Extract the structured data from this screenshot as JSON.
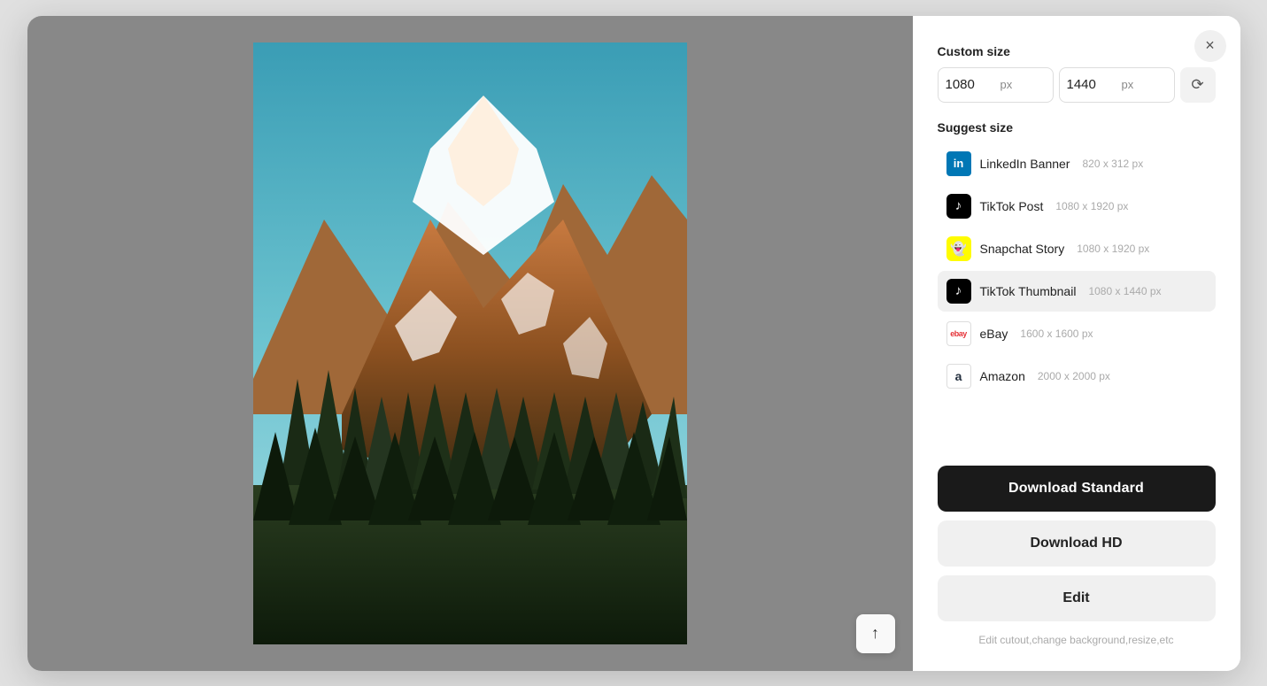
{
  "modal": {
    "close_label": "×"
  },
  "custom_size": {
    "label": "Custom size",
    "width_value": "1080",
    "height_value": "1440",
    "width_unit": "px",
    "height_unit": "px",
    "aspect_icon": "⟳"
  },
  "suggest_size": {
    "label": "Suggest size",
    "items": [
      {
        "id": "linkedin-banner",
        "icon_type": "li",
        "icon_text": "in",
        "name": "LinkedIn Banner",
        "dims": "820 x 312 px",
        "active": false
      },
      {
        "id": "tiktok-post",
        "icon_type": "tt",
        "icon_text": "♪",
        "name": "TikTok Post",
        "dims": "1080 x 1920 px",
        "active": false
      },
      {
        "id": "snapchat-story",
        "icon_type": "sc",
        "icon_text": "👻",
        "name": "Snapchat Story",
        "dims": "1080 x 1920 px",
        "active": false
      },
      {
        "id": "tiktok-thumbnail",
        "icon_type": "tt",
        "icon_text": "♪",
        "name": "TikTok Thumbnail",
        "dims": "1080 x 1440 px",
        "active": true
      },
      {
        "id": "ebay",
        "icon_type": "eb",
        "icon_text": "ebay",
        "name": "eBay",
        "dims": "1600 x 1600 px",
        "active": false
      },
      {
        "id": "amazon",
        "icon_type": "az",
        "icon_text": "a",
        "name": "Amazon",
        "dims": "2000 x 2000 px",
        "active": false
      }
    ]
  },
  "actions": {
    "download_standard": "Download Standard",
    "download_hd": "Download HD",
    "edit": "Edit",
    "edit_hint": "Edit cutout,change background,resize,etc"
  },
  "canvas": {
    "upload_icon": "⬆"
  }
}
